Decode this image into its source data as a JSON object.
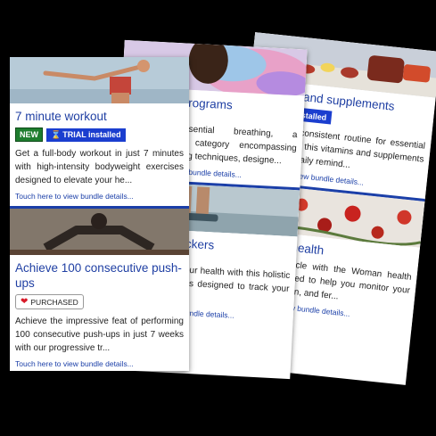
{
  "cards": [
    {
      "id": "right",
      "tiles": [
        {
          "title": "Vitamins and supplements",
          "badge_trial": "TRIAL installed",
          "description": "Establish a consistent routine for essential nutrients with this vitamins and supplements bundle. Set daily remind...",
          "link": "Touch here to view bundle details..."
        },
        {
          "title": "Women's health",
          "description": "Track your cycle with the Woman health bundle, designed to help you monitor your period, ovulation, and fer...",
          "link": "Touch here to view bundle details..."
        }
      ]
    },
    {
      "id": "mid",
      "tiles": [
        {
          "title": "Breathing programs",
          "description": "Discover essential breathing, a comprehensive category encompassing various breathing techniques, designe...",
          "link": "Touch here to view bundle details..."
        },
        {
          "title": "Wellness trackers",
          "description": "Take charge of your health with this holistic bundle of activities designed to track your well-being. E...",
          "link": "Touch here to view bundle details..."
        }
      ]
    },
    {
      "id": "front",
      "tiles": [
        {
          "title": "7 minute workout",
          "badge_new": "NEW",
          "badge_trial": "TRIAL installed",
          "description": "Get a full-body workout in just 7 minutes with high-intensity bodyweight exercises designed to elevate your he...",
          "link": "Touch here to view bundle details..."
        },
        {
          "title": "Achieve 100 consecutive push-ups",
          "badge_purchased": "PURCHASED",
          "description": "Achieve the impressive feat of performing 100 consecutive push-ups in just 7 weeks with our progressive tr...",
          "link": "Touch here to view bundle details..."
        }
      ]
    }
  ],
  "icons": {
    "trial": "hourglass-icon",
    "purchased": "heart-icon"
  },
  "colors": {
    "accent": "#1f3fa3",
    "badge_new": "#1e7d2e",
    "badge_trial": "#1b3ecf",
    "heart": "#d81b2a"
  }
}
